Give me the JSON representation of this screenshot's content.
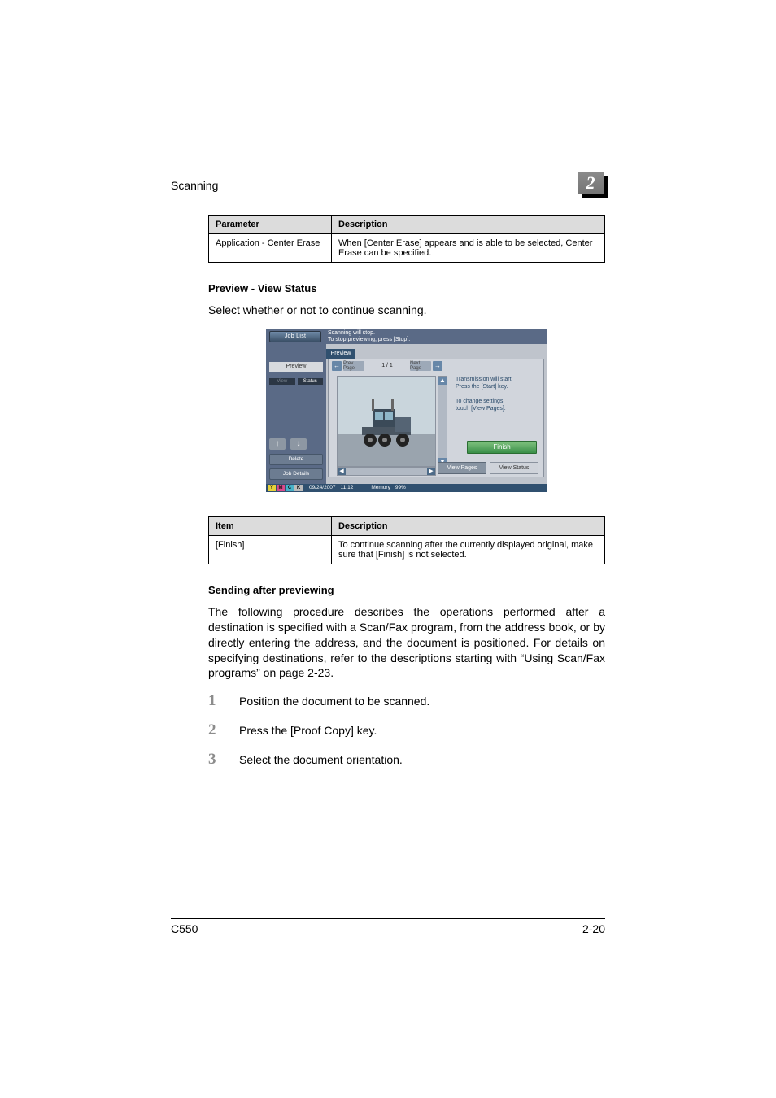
{
  "running_head": "Scanning",
  "chapter_number": "2",
  "table1": {
    "headers": [
      "Parameter",
      "Description"
    ],
    "rows": [
      [
        "Application - Center Erase",
        "When [Center Erase] appears and is able to be selected, Center Erase can be specified."
      ]
    ]
  },
  "section1": {
    "heading": "Preview - View Status",
    "para": "Select whether or not to continue scanning."
  },
  "screenshot": {
    "joblist": "Job List",
    "topmsg1": "Scanning will stop.",
    "topmsg2": "To stop previewing, press [Stop].",
    "side_preview": "Preview",
    "side_view": "View",
    "side_status": "Status",
    "side_up": "↑",
    "side_down": "↓",
    "side_delete": "Delete",
    "side_jobdetails": "Job Details",
    "prev_tab": "Preview",
    "prev_left": "←",
    "prev_pgbtn_l": "Prev. Page",
    "page_indicator": "1 /   1",
    "prev_pgbtn_r": "Next Page",
    "prev_right": "→",
    "msg1": "Transmission will start.",
    "msg2": "Press the [Start] key.",
    "msg3": "To change settings,",
    "msg4": "touch [View Pages].",
    "finish": "Finish",
    "view_pages": "View Pages",
    "view_status": "View Status",
    "date": "09/24/2007",
    "time": "11:12",
    "mem_label": "Memory",
    "mem_val": "99%",
    "y": "Y",
    "m": "M",
    "c": "C",
    "k": "K"
  },
  "table2": {
    "headers": [
      "Item",
      "Description"
    ],
    "rows": [
      [
        "[Finish]",
        "To continue scanning after the currently displayed original, make sure that [Finish] is not selected."
      ]
    ]
  },
  "section2": {
    "heading": "Sending after previewing",
    "para": "The following procedure describes the operations performed after a destination is specified with a Scan/Fax program, from the address book, or by directly entering the address, and the document is positioned. For details on specifying destinations, refer to the descriptions starting with “Using Scan/Fax programs” on page 2-23."
  },
  "steps": [
    "Position the document to be scanned.",
    "Press the [Proof Copy] key.",
    "Select the document orientation."
  ],
  "footer_left": "C550",
  "footer_right": "2-20"
}
